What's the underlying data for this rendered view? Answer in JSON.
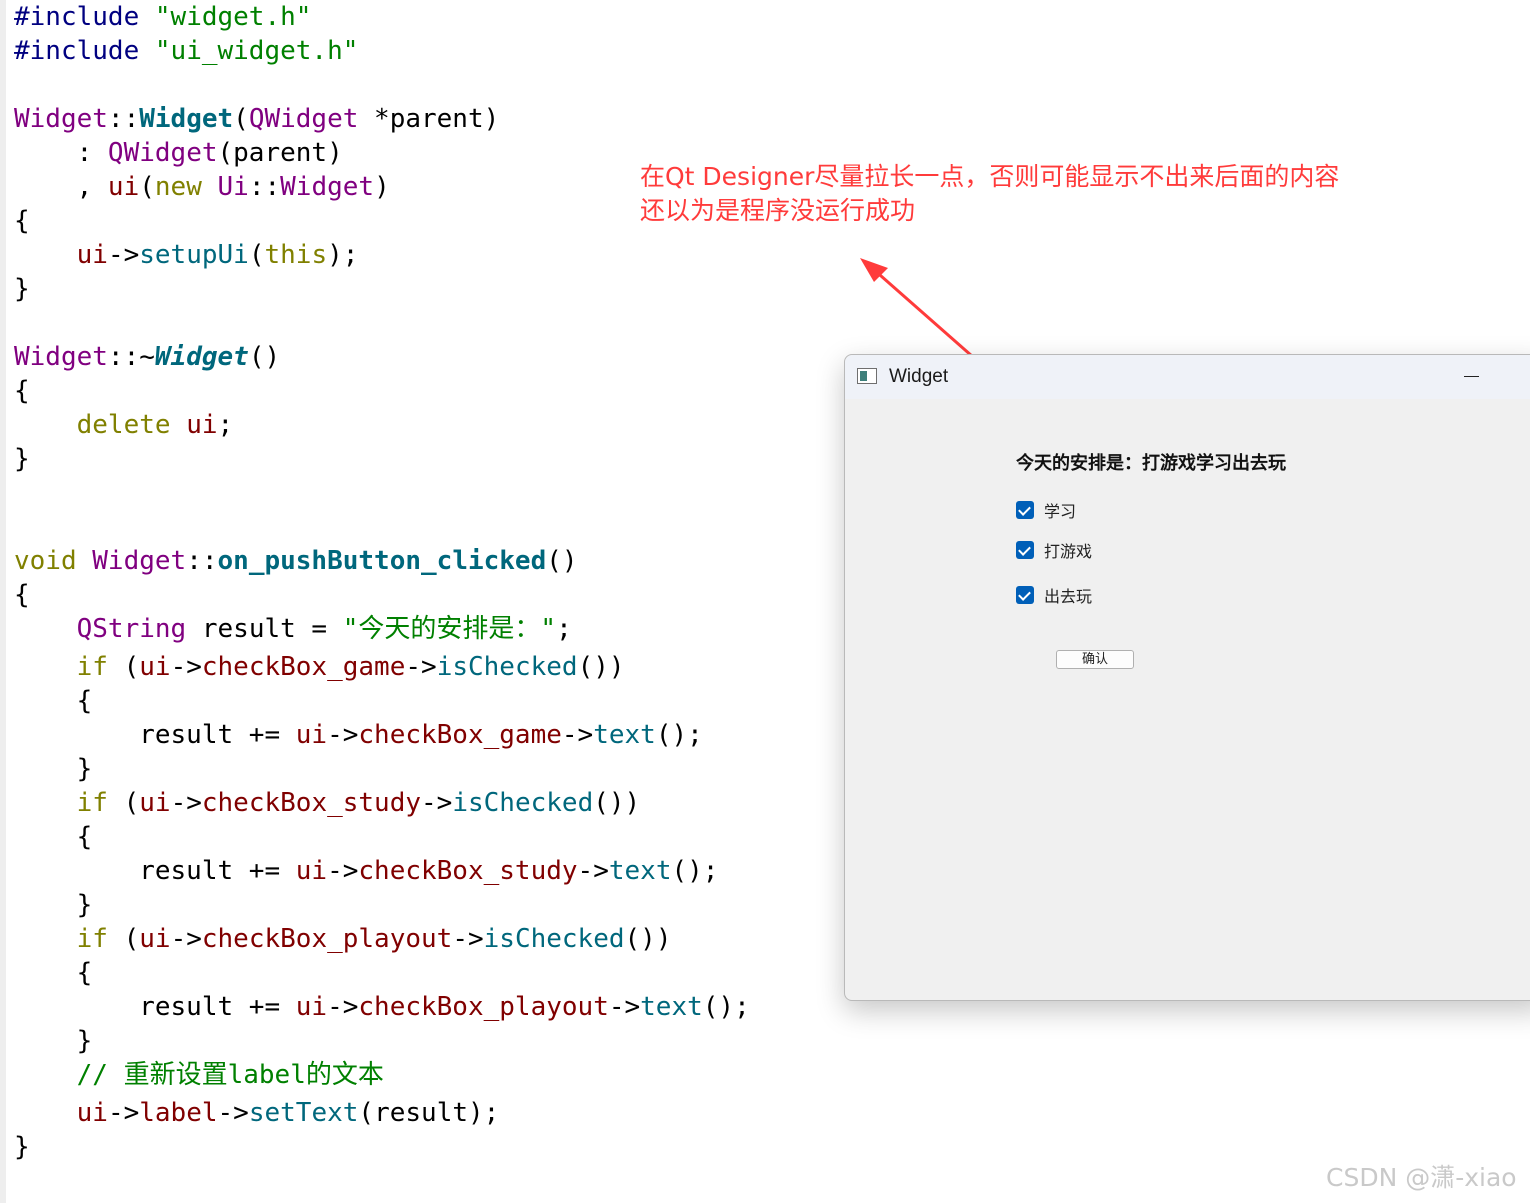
{
  "code": {
    "lines": [
      {
        "tokens": [
          {
            "t": "#include ",
            "c": "pre"
          },
          {
            "t": "\"widget.h\"",
            "c": "str"
          }
        ]
      },
      {
        "tokens": [
          {
            "t": "#include ",
            "c": "pre"
          },
          {
            "t": "\"ui_widget.h\"",
            "c": "str"
          }
        ]
      },
      {
        "tokens": []
      },
      {
        "tokens": [
          {
            "t": "Widget",
            "c": "cls"
          },
          {
            "t": "::",
            "c": "plain"
          },
          {
            "t": "Widget",
            "c": "fnb"
          },
          {
            "t": "(",
            "c": "plain"
          },
          {
            "t": "QWidget",
            "c": "cls"
          },
          {
            "t": " *parent)",
            "c": "plain"
          }
        ]
      },
      {
        "tokens": [
          {
            "t": "    : ",
            "c": "plain"
          },
          {
            "t": "QWidget",
            "c": "cls"
          },
          {
            "t": "(parent)",
            "c": "plain"
          }
        ]
      },
      {
        "tokens": [
          {
            "t": "    , ",
            "c": "plain"
          },
          {
            "t": "ui",
            "c": "mem"
          },
          {
            "t": "(",
            "c": "plain"
          },
          {
            "t": "new",
            "c": "kw"
          },
          {
            "t": " ",
            "c": "plain"
          },
          {
            "t": "Ui",
            "c": "cls"
          },
          {
            "t": "::",
            "c": "plain"
          },
          {
            "t": "Widget",
            "c": "cls"
          },
          {
            "t": ")",
            "c": "plain"
          }
        ]
      },
      {
        "tokens": [
          {
            "t": "{",
            "c": "plain"
          }
        ]
      },
      {
        "tokens": [
          {
            "t": "    ",
            "c": "plain"
          },
          {
            "t": "ui",
            "c": "mem"
          },
          {
            "t": "->",
            "c": "plain"
          },
          {
            "t": "setupUi",
            "c": "fn"
          },
          {
            "t": "(",
            "c": "plain"
          },
          {
            "t": "this",
            "c": "kw"
          },
          {
            "t": ");",
            "c": "plain"
          }
        ]
      },
      {
        "tokens": [
          {
            "t": "}",
            "c": "plain"
          }
        ]
      },
      {
        "tokens": []
      },
      {
        "tokens": [
          {
            "t": "Widget",
            "c": "cls"
          },
          {
            "t": "::~",
            "c": "plain"
          },
          {
            "t": "Widget",
            "c": "fni"
          },
          {
            "t": "()",
            "c": "plain"
          }
        ]
      },
      {
        "tokens": [
          {
            "t": "{",
            "c": "plain"
          }
        ]
      },
      {
        "tokens": [
          {
            "t": "    ",
            "c": "plain"
          },
          {
            "t": "delete",
            "c": "kw"
          },
          {
            "t": " ",
            "c": "plain"
          },
          {
            "t": "ui",
            "c": "mem"
          },
          {
            "t": ";",
            "c": "plain"
          }
        ]
      },
      {
        "tokens": [
          {
            "t": "}",
            "c": "plain"
          }
        ]
      },
      {
        "tokens": []
      },
      {
        "tokens": []
      },
      {
        "tokens": [
          {
            "t": "void",
            "c": "kw"
          },
          {
            "t": " ",
            "c": "plain"
          },
          {
            "t": "Widget",
            "c": "cls"
          },
          {
            "t": "::",
            "c": "plain"
          },
          {
            "t": "on_pushButton_clicked",
            "c": "fnb"
          },
          {
            "t": "()",
            "c": "plain"
          }
        ]
      },
      {
        "tokens": [
          {
            "t": "{",
            "c": "plain"
          }
        ]
      },
      {
        "tokens": [
          {
            "t": "    ",
            "c": "plain"
          },
          {
            "t": "QString",
            "c": "cls"
          },
          {
            "t": " result = ",
            "c": "plain"
          },
          {
            "t": "\"今天的安排是：\"",
            "c": "str"
          },
          {
            "t": ";",
            "c": "plain"
          }
        ]
      },
      {
        "tokens": [
          {
            "t": "    ",
            "c": "plain"
          },
          {
            "t": "if",
            "c": "kw"
          },
          {
            "t": " (",
            "c": "plain"
          },
          {
            "t": "ui",
            "c": "mem"
          },
          {
            "t": "->",
            "c": "plain"
          },
          {
            "t": "checkBox_game",
            "c": "mem"
          },
          {
            "t": "->",
            "c": "plain"
          },
          {
            "t": "isChecked",
            "c": "fn"
          },
          {
            "t": "())",
            "c": "plain"
          }
        ]
      },
      {
        "tokens": [
          {
            "t": "    {",
            "c": "plain"
          }
        ]
      },
      {
        "tokens": [
          {
            "t": "        result += ",
            "c": "plain"
          },
          {
            "t": "ui",
            "c": "mem"
          },
          {
            "t": "->",
            "c": "plain"
          },
          {
            "t": "checkBox_game",
            "c": "mem"
          },
          {
            "t": "->",
            "c": "plain"
          },
          {
            "t": "text",
            "c": "fn"
          },
          {
            "t": "();",
            "c": "plain"
          }
        ]
      },
      {
        "tokens": [
          {
            "t": "    }",
            "c": "plain"
          }
        ]
      },
      {
        "tokens": [
          {
            "t": "    ",
            "c": "plain"
          },
          {
            "t": "if",
            "c": "kw"
          },
          {
            "t": " (",
            "c": "plain"
          },
          {
            "t": "ui",
            "c": "mem"
          },
          {
            "t": "->",
            "c": "plain"
          },
          {
            "t": "checkBox_study",
            "c": "mem"
          },
          {
            "t": "->",
            "c": "plain"
          },
          {
            "t": "isChecked",
            "c": "fn"
          },
          {
            "t": "())",
            "c": "plain"
          }
        ]
      },
      {
        "tokens": [
          {
            "t": "    {",
            "c": "plain"
          }
        ]
      },
      {
        "tokens": [
          {
            "t": "        result += ",
            "c": "plain"
          },
          {
            "t": "ui",
            "c": "mem"
          },
          {
            "t": "->",
            "c": "plain"
          },
          {
            "t": "checkBox_study",
            "c": "mem"
          },
          {
            "t": "->",
            "c": "plain"
          },
          {
            "t": "text",
            "c": "fn"
          },
          {
            "t": "();",
            "c": "plain"
          }
        ]
      },
      {
        "tokens": [
          {
            "t": "    }",
            "c": "plain"
          }
        ]
      },
      {
        "tokens": [
          {
            "t": "    ",
            "c": "plain"
          },
          {
            "t": "if",
            "c": "kw"
          },
          {
            "t": " (",
            "c": "plain"
          },
          {
            "t": "ui",
            "c": "mem"
          },
          {
            "t": "->",
            "c": "plain"
          },
          {
            "t": "checkBox_playout",
            "c": "mem"
          },
          {
            "t": "->",
            "c": "plain"
          },
          {
            "t": "isChecked",
            "c": "fn"
          },
          {
            "t": "())",
            "c": "plain"
          }
        ]
      },
      {
        "tokens": [
          {
            "t": "    {",
            "c": "plain"
          }
        ]
      },
      {
        "tokens": [
          {
            "t": "        result += ",
            "c": "plain"
          },
          {
            "t": "ui",
            "c": "mem"
          },
          {
            "t": "->",
            "c": "plain"
          },
          {
            "t": "checkBox_playout",
            "c": "mem"
          },
          {
            "t": "->",
            "c": "plain"
          },
          {
            "t": "text",
            "c": "fn"
          },
          {
            "t": "();",
            "c": "plain"
          }
        ]
      },
      {
        "tokens": [
          {
            "t": "    }",
            "c": "plain"
          }
        ]
      },
      {
        "tokens": [
          {
            "t": "    ",
            "c": "plain"
          },
          {
            "t": "// 重新设置label的文本",
            "c": "com"
          }
        ]
      },
      {
        "tokens": [
          {
            "t": "    ",
            "c": "plain"
          },
          {
            "t": "ui",
            "c": "mem"
          },
          {
            "t": "->",
            "c": "plain"
          },
          {
            "t": "label",
            "c": "mem"
          },
          {
            "t": "->",
            "c": "plain"
          },
          {
            "t": "setText",
            "c": "fn"
          },
          {
            "t": "(result);",
            "c": "plain"
          }
        ]
      },
      {
        "tokens": [
          {
            "t": "}",
            "c": "plain"
          }
        ]
      }
    ]
  },
  "annotation": {
    "line1": "在Qt Designer尽量拉长一点，否则可能显示不出来后面的内容",
    "line2": "还以为是程序没运行成功",
    "color": "#ff3b3b"
  },
  "window": {
    "title": "Widget",
    "minimize_icon": "minimize-icon",
    "app_icon": "qt-app-icon",
    "label_text": "今天的安排是：打游戏学习出去玩",
    "checkboxes": [
      {
        "name": "checkbox-study",
        "label": "学习",
        "checked": true
      },
      {
        "name": "checkbox-game",
        "label": "打游戏",
        "checked": true
      },
      {
        "name": "checkbox-playout",
        "label": "出去玩",
        "checked": true
      }
    ],
    "confirm_button": "确认",
    "accent": "#005fb8"
  },
  "watermark": "CSDN @潇-xiao"
}
